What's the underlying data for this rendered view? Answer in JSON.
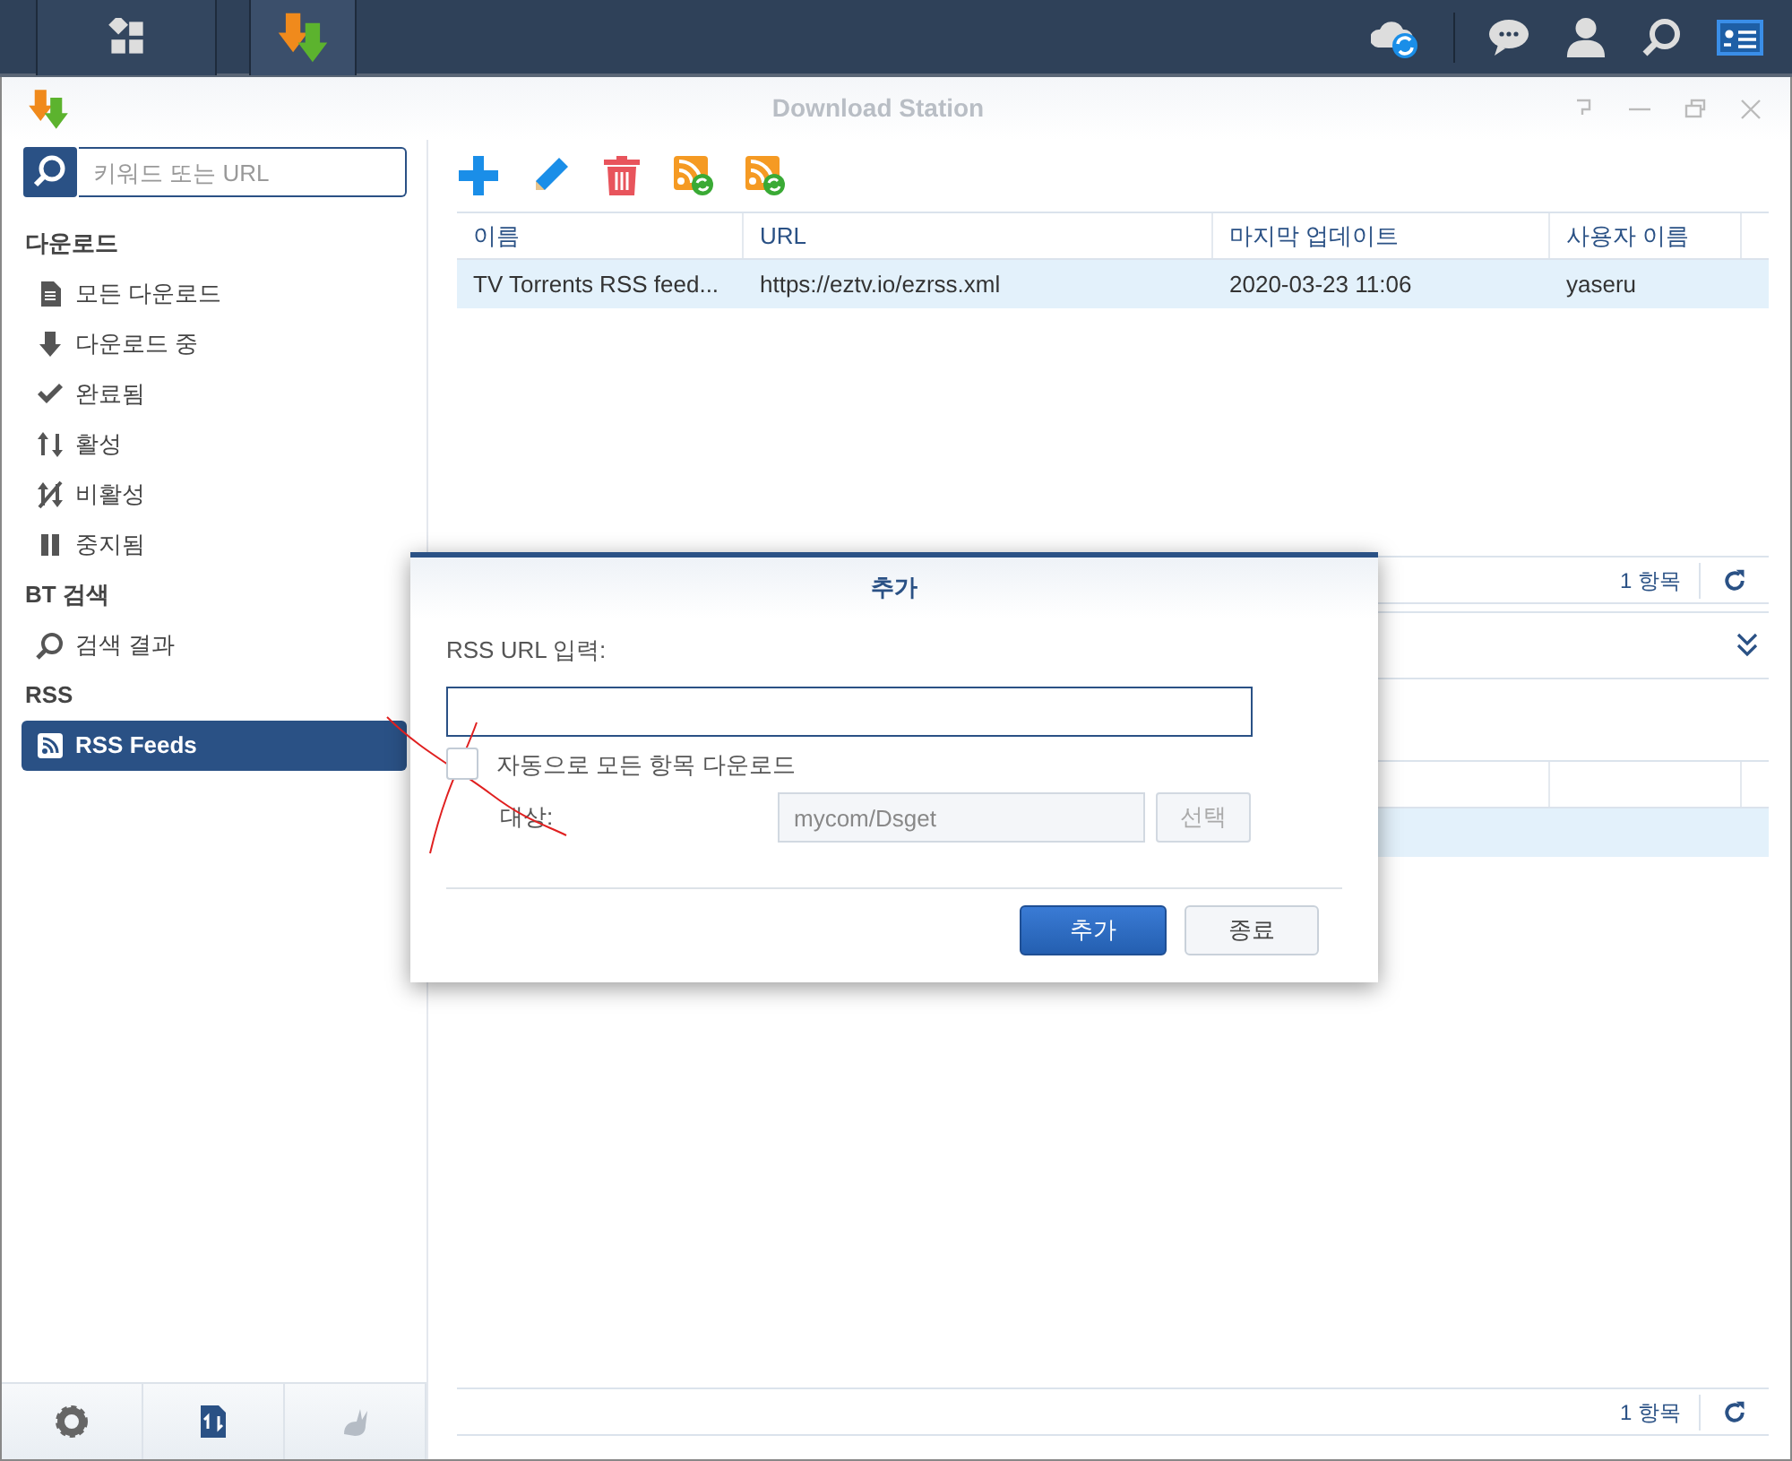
{
  "window": {
    "title": "Download Station"
  },
  "search": {
    "placeholder": "키워드 또는 URL"
  },
  "sidebar": {
    "sections": [
      {
        "title": "다운로드",
        "items": [
          {
            "label": "모든 다운로드",
            "selected": false
          },
          {
            "label": "다운로드 중",
            "selected": false
          },
          {
            "label": "완료됨",
            "selected": false
          },
          {
            "label": "활성",
            "selected": false
          },
          {
            "label": "비활성",
            "selected": false
          },
          {
            "label": "중지됨",
            "selected": false
          }
        ]
      },
      {
        "title": "BT 검색",
        "items": [
          {
            "label": "검색 결과",
            "selected": false
          }
        ]
      },
      {
        "title": "RSS",
        "items": [
          {
            "label": "RSS Feeds",
            "selected": true
          }
        ]
      }
    ]
  },
  "feeds_table": {
    "columns": [
      "이름",
      "URL",
      "마지막 업데이트",
      "사용자 이름"
    ],
    "rows": [
      {
        "cells": [
          "TV Torrents RSS feed...",
          "https://eztv.io/ezrss.xml",
          "2020-03-23 11:06",
          "yaseru"
        ],
        "selected": true
      }
    ],
    "count": "1 항목"
  },
  "items_table": {
    "rows": [
      {
        "selected": true
      }
    ],
    "count": "1 항목"
  },
  "dialog": {
    "title": "추가",
    "url_label": "RSS URL 입력:",
    "auto_download": {
      "label": "자동으로 모든 항목 다운로드",
      "checked": false
    },
    "destination_label": "대상:",
    "destination_value": "mycom/Dsget",
    "select_button": "선택",
    "buttons": [
      {
        "label": "추가",
        "primary": true
      },
      {
        "label": "종료",
        "primary": false
      }
    ]
  }
}
